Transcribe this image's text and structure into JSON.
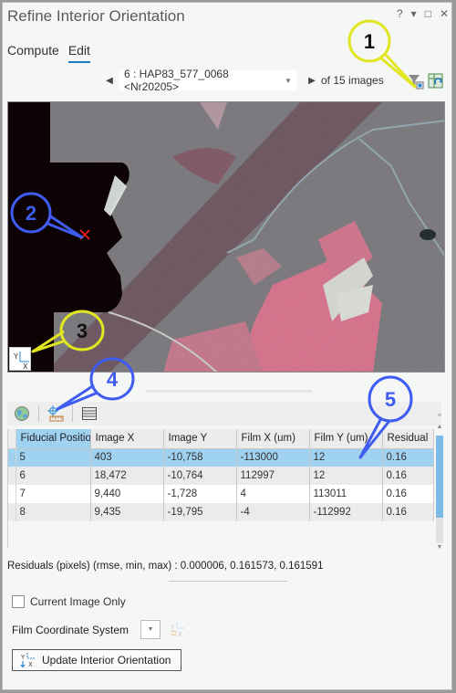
{
  "window": {
    "title": "Refine Interior Orientation",
    "controls": {
      "help": "?",
      "menu": "▾",
      "maximize": "□",
      "close": "✕"
    }
  },
  "tabs": [
    {
      "label": "Compute",
      "active": false
    },
    {
      "label": "Edit",
      "active": true
    }
  ],
  "image_nav": {
    "prev_icon": "◀",
    "selected_image": "6 : HAP83_577_0068 <Nr20205>",
    "dropdown_icon": "▼",
    "next_icon": "▶",
    "count_text": "of 15 images"
  },
  "toolbar_icons": {
    "filter": "filter-icon",
    "refresh": "refresh-grid-icon"
  },
  "viewer": {
    "marker_icon": "✕",
    "axis_labels": {
      "y": "Y",
      "x": "X"
    }
  },
  "grid_toolbar": {
    "globe": "globe-icon",
    "measure": "crosshair-ruler-icon",
    "table": "table-icon",
    "menu_icon": "≡"
  },
  "table": {
    "columns": [
      "Fiducial Position",
      "Image X",
      "Image Y",
      "Film X (um)",
      "Film Y (um)",
      "Residual"
    ],
    "rows": [
      {
        "fiducial": "5",
        "image_x": "403",
        "image_y": "-10,758",
        "film_x": "-113000",
        "film_y": "12",
        "residual": "0.16",
        "selected": true
      },
      {
        "fiducial": "6",
        "image_x": "18,472",
        "image_y": "-10,764",
        "film_x": "112997",
        "film_y": "12",
        "residual": "0.16",
        "selected": false
      },
      {
        "fiducial": "7",
        "image_x": "9,440",
        "image_y": "-1,728",
        "film_x": "4",
        "film_y": "113011",
        "residual": "0.16",
        "selected": false
      },
      {
        "fiducial": "8",
        "image_x": "9,435",
        "image_y": "-19,795",
        "film_x": "-4",
        "film_y": "-112992",
        "residual": "0.16",
        "selected": false
      }
    ]
  },
  "scrollbar": {
    "up": "▲",
    "down": "▼"
  },
  "residuals": {
    "label": "Residuals (pixels) (rmse, min, max)",
    "values": " : 0.000006, 0.161573, 0.161591"
  },
  "options": {
    "current_image_only_label": "Current Image Only",
    "current_image_only_checked": false,
    "film_coordinate_system_label": "Film Coordinate System",
    "film_coordinate_system_value": "",
    "dropdown_icon": "▼"
  },
  "update_button": {
    "label": "Update Interior Orientation"
  },
  "callouts": [
    {
      "number": "1",
      "color": "#e0e620"
    },
    {
      "number": "2",
      "color": "#3e5cf0"
    },
    {
      "number": "3",
      "color": "#e0e620"
    },
    {
      "number": "4",
      "color": "#3e5cf0"
    },
    {
      "number": "5",
      "color": "#3e5cf0"
    }
  ]
}
